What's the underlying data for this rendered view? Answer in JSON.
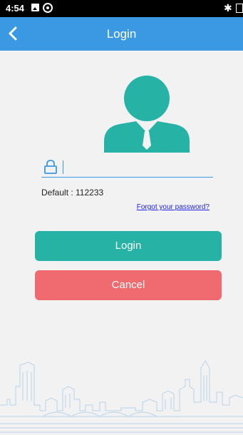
{
  "status_bar": {
    "time": "4:54",
    "icons": [
      "image-icon",
      "sync-icon",
      "bluetooth-icon",
      "battery-icon"
    ]
  },
  "app_bar": {
    "title": "Login",
    "back_icon": "chevron-left-icon",
    "background": "#3a99e2"
  },
  "form": {
    "password_value": "",
    "password_placeholder": "",
    "default_hint": "Default : 112233",
    "forgot_link": "Forgot your password?"
  },
  "buttons": {
    "login_label": "Login",
    "cancel_label": "Cancel"
  },
  "colors": {
    "accent": "#3a99e2",
    "avatar": "#26b3a6",
    "login": "#26b3a6",
    "cancel": "#f06b70",
    "skyline": "#b8d4ea"
  }
}
